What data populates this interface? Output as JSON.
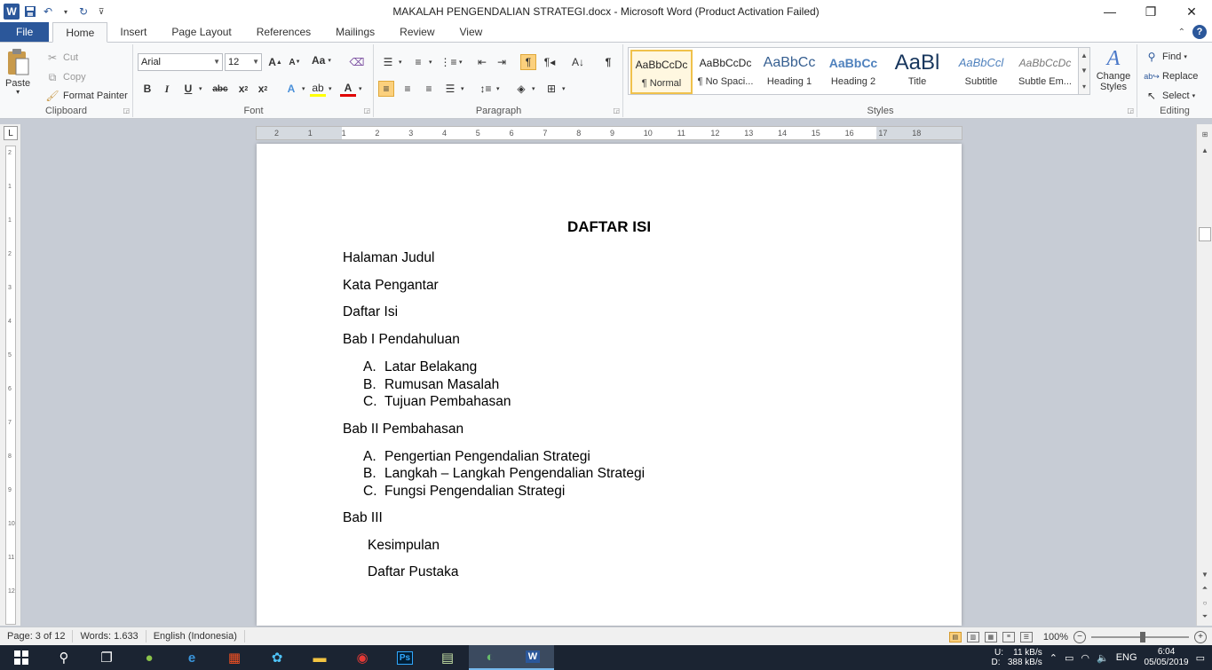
{
  "window": {
    "title": "MAKALAH PENGENDALIAN STRATEGI.docx  -  Microsoft Word (Product Activation Failed)"
  },
  "qat": {
    "app_icon": "word-icon",
    "save_icon": "save-icon",
    "undo_icon": "undo-icon",
    "redo_icon": "redo-icon"
  },
  "tabs": [
    {
      "label": "File"
    },
    {
      "label": "Home"
    },
    {
      "label": "Insert"
    },
    {
      "label": "Page Layout"
    },
    {
      "label": "References"
    },
    {
      "label": "Mailings"
    },
    {
      "label": "Review"
    },
    {
      "label": "View"
    }
  ],
  "ribbon": {
    "clipboard": {
      "label": "Clipboard",
      "paste": "Paste",
      "cut": "Cut",
      "copy": "Copy",
      "format_painter": "Format Painter"
    },
    "font": {
      "label": "Font",
      "font_name": "Arial",
      "font_size": "12",
      "change_case": "Aa"
    },
    "paragraph": {
      "label": "Paragraph"
    },
    "styles": {
      "label": "Styles",
      "items": [
        {
          "sample": "AaBbCcDc",
          "name": "¶ Normal"
        },
        {
          "sample": "AaBbCcDc",
          "name": "¶ No Spaci..."
        },
        {
          "sample": "AaBbCc",
          "name": "Heading 1"
        },
        {
          "sample": "AaBbCc",
          "name": "Heading 2"
        },
        {
          "sample": "AaBl",
          "name": "Title"
        },
        {
          "sample": "AaBbCcl",
          "name": "Subtitle"
        },
        {
          "sample": "AaBbCcDc",
          "name": "Subtle Em..."
        }
      ],
      "change_styles": "Change Styles"
    },
    "editing": {
      "label": "Editing",
      "find": "Find",
      "replace": "Replace",
      "select": "Select"
    }
  },
  "ruler": {
    "h_ticks": [
      "2",
      "1",
      "1",
      "2",
      "3",
      "4",
      "5",
      "6",
      "7",
      "8",
      "9",
      "10",
      "11",
      "12",
      "13",
      "14",
      "15",
      "16",
      "17",
      "18"
    ],
    "v_ticks": [
      "2",
      "1",
      "1",
      "2",
      "3",
      "4",
      "5",
      "6",
      "7",
      "8",
      "9",
      "10",
      "11",
      "12"
    ]
  },
  "document": {
    "title": "DAFTAR ISI",
    "lines": [
      {
        "text": "Halaman Judul"
      },
      {
        "text": "Kata Pengantar"
      },
      {
        "text": "Daftar Isi"
      },
      {
        "text": "Bab I Pendahuluan"
      }
    ],
    "bab1_items": [
      {
        "marker": "A.",
        "text": "Latar Belakang"
      },
      {
        "marker": "B.",
        "text": "Rumusan Masalah"
      },
      {
        "marker": "C.",
        "text": "Tujuan Pembahasan"
      }
    ],
    "bab2_title": "Bab II Pembahasan",
    "bab2_items": [
      {
        "marker": "A.",
        "text": "Pengertian Pengendalian Strategi"
      },
      {
        "marker": "B.",
        "text": "Langkah – Langkah Pengendalian Strategi"
      },
      {
        "marker": "C.",
        "text": "Fungsi Pengendalian Strategi"
      }
    ],
    "bab3_title": "Bab III",
    "bab3_items": [
      {
        "text": "Kesimpulan"
      },
      {
        "text": "Daftar Pustaka"
      }
    ]
  },
  "status": {
    "page": "Page: 3 of 12",
    "words": "Words: 1.633",
    "language": "English (Indonesia)",
    "zoom": "100%"
  },
  "taskbar": {
    "net_up": "11 kB/s",
    "net_down": "388 kB/s",
    "net_u_label": "U:",
    "net_d_label": "D:",
    "lang": "ENG",
    "time": "6:04",
    "date": "05/05/2019"
  }
}
